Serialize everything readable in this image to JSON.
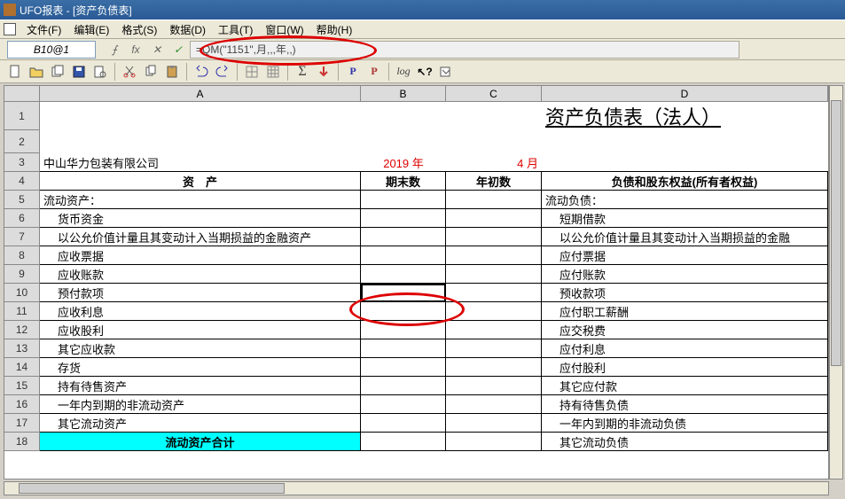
{
  "title": "UFO报表 - [资产负债表]",
  "menus": [
    "文件(F)",
    "编辑(E)",
    "格式(S)",
    "数据(D)",
    "工具(T)",
    "窗口(W)",
    "帮助(H)"
  ],
  "namebox": "B10@1",
  "formula": "=QM(\"1151\",月,,,年,,)",
  "toolbar_icons": [
    "new",
    "open",
    "cards",
    "save",
    "preview",
    "sep",
    "cut",
    "copy",
    "paste",
    "sep",
    "undo",
    "redo",
    "sep",
    "grid1",
    "grid2",
    "sep",
    "sigma",
    "arrow",
    "sep",
    "bold-p",
    "bold-p2",
    "sep",
    "log",
    "help-arrow",
    "dropdown"
  ],
  "columns": [
    "A",
    "B",
    "C",
    "D"
  ],
  "sheet_title": "资产负债表（法人）",
  "company": "中山华力包装有限公司",
  "year": "2019 年",
  "month": "4 月",
  "headers": {
    "a": "资　产",
    "b": "期末数",
    "c": "年初数",
    "d": "负债和股东权益(所有者权益)"
  },
  "section_left": "流动资产：",
  "section_right": "流动负债：",
  "rows": [
    {
      "n": 6,
      "a": "货币资金",
      "d": "短期借款"
    },
    {
      "n": 7,
      "a": "以公允价值计量且其变动计入当期损益的金融资产",
      "d": "以公允价值计量且其变动计入当期损益的金融"
    },
    {
      "n": 8,
      "a": "应收票据",
      "d": "应付票据"
    },
    {
      "n": 9,
      "a": "应收账款",
      "d": "应付账款"
    },
    {
      "n": 10,
      "a": "预付款项",
      "d": "预收款项"
    },
    {
      "n": 11,
      "a": "应收利息",
      "d": "应付职工薪酬"
    },
    {
      "n": 12,
      "a": "应收股利",
      "d": "应交税费"
    },
    {
      "n": 13,
      "a": "其它应收款",
      "d": "应付利息"
    },
    {
      "n": 14,
      "a": "存货",
      "d": "应付股利"
    },
    {
      "n": 15,
      "a": "持有待售资产",
      "d": "其它应付款"
    },
    {
      "n": 16,
      "a": "一年内到期的非流动资产",
      "d": "持有待售负债"
    },
    {
      "n": 17,
      "a": "其它流动资产",
      "d": "一年内到期的非流动负债"
    }
  ],
  "total_row": {
    "n": 18,
    "a": "流动资产合计",
    "d": "其它流动负债"
  }
}
